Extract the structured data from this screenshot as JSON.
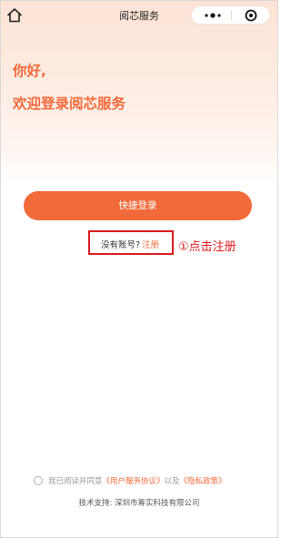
{
  "navbar": {
    "title": "阅芯服务",
    "home_icon": "home-icon",
    "more_icon": "more-dots-icon",
    "close_icon": "target-close-icon"
  },
  "greeting": {
    "line1": "你好,",
    "line2": "欢迎登录阅芯服务"
  },
  "login": {
    "quick_login_label": "快捷登录"
  },
  "register": {
    "prompt": "没有账号?",
    "link_label": "注册"
  },
  "annotation": {
    "text": "①点击注册",
    "color": "#d9191c"
  },
  "agreement": {
    "prefix": "我已阅读并同意",
    "user_agreement": "《用户服务协议》",
    "connector": "以及",
    "privacy_policy": "《隐私政策》"
  },
  "footer": {
    "support_text": "技术支持: 深圳市筹实科技有限公司"
  },
  "colors": {
    "accent": "#f26a3a",
    "annotation_red": "#d9191c"
  }
}
